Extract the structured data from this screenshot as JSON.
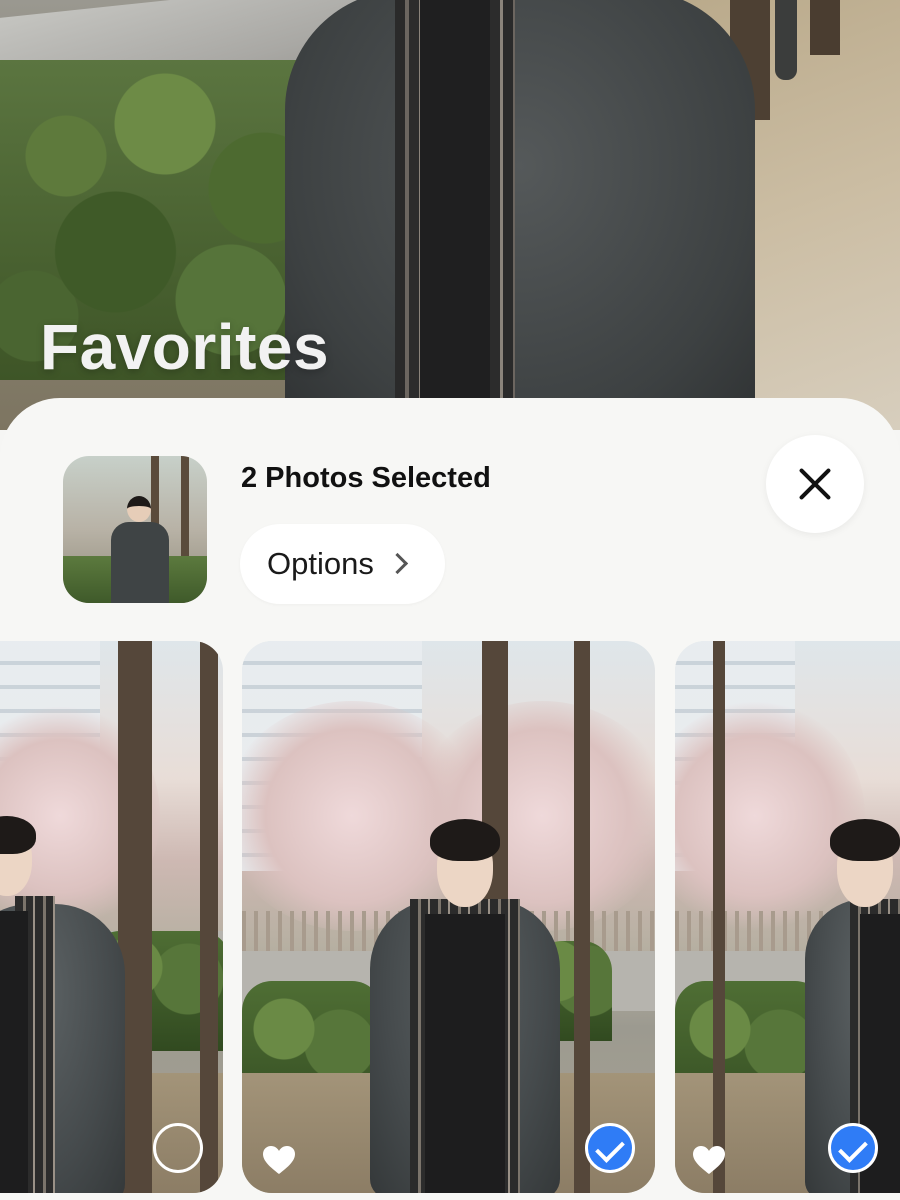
{
  "album": {
    "title": "Favorites"
  },
  "selection": {
    "title": "2 Photos Selected",
    "options_label": "Options",
    "close_icon": "close-icon",
    "chevron_icon": "chevron-right-icon"
  },
  "photos": [
    {
      "favorite": false,
      "selected": false,
      "selection_icon": "empty-circle-icon"
    },
    {
      "favorite": false,
      "selected": true,
      "selection_icon": "checkmark-circle-icon"
    },
    {
      "favorite": true,
      "selected": true,
      "selection_icon": "checkmark-circle-icon"
    }
  ],
  "colors": {
    "accent": "#2f7cf6",
    "sheet": "#f7f7f5",
    "button": "#ffffff"
  }
}
